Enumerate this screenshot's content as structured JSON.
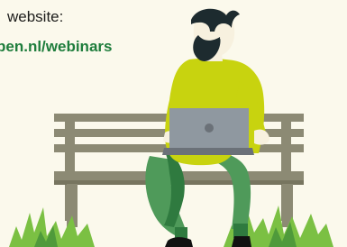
{
  "text": {
    "line1": "website:",
    "line2": "pen.nl/webinars"
  },
  "illustration": {
    "subject": "person-with-laptop-on-bench",
    "colors": {
      "background": "#fbf9ec",
      "bench": "#8c8a74",
      "bench_shadow": "#77755f",
      "shirt": "#c8d30f",
      "pants": "#4f9a5a",
      "pants_dark": "#2f7a3f",
      "skin": "#f7f1df",
      "hair": "#1d2b2f",
      "laptop": "#8f98a0",
      "laptop_dark": "#6b7178",
      "grass": "#7bc043",
      "grass_dark": "#4f9a3b",
      "shoes": "#111111",
      "link_green": "#1e7d3c",
      "text_dark": "#1d1d1b"
    }
  }
}
